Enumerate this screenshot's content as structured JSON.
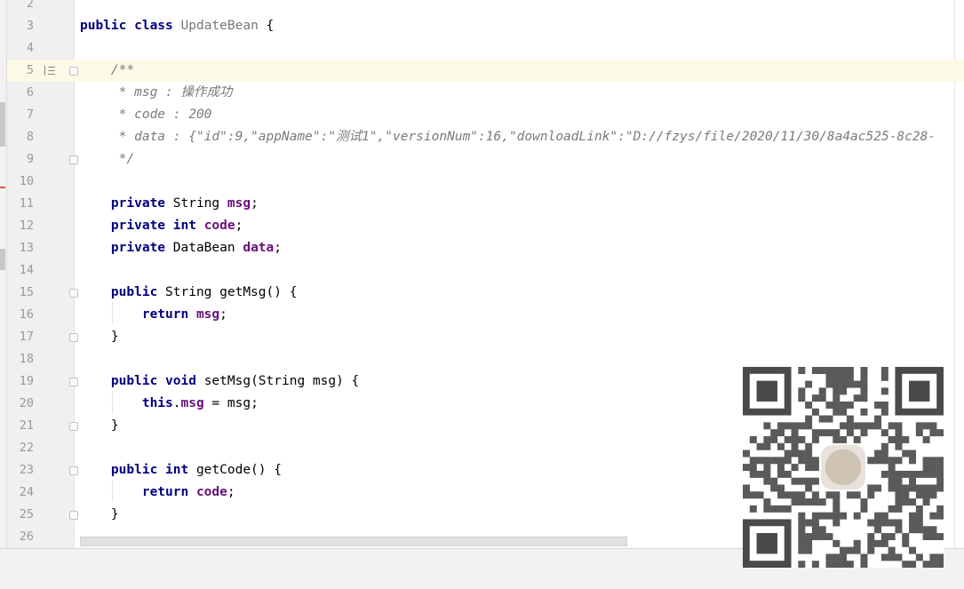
{
  "lines": [
    {
      "n": "2",
      "tokens": []
    },
    {
      "n": "3",
      "tokens": [
        {
          "t": "public class ",
          "c": "kw"
        },
        {
          "t": "UpdateBean",
          "c": "cls"
        },
        {
          "t": " {",
          "c": ""
        }
      ]
    },
    {
      "n": "4",
      "tokens": []
    },
    {
      "n": "5",
      "current": true,
      "tokens": [
        {
          "t": "    /**",
          "c": "cmt"
        }
      ]
    },
    {
      "n": "6",
      "tokens": [
        {
          "t": "     * msg : 操作成功",
          "c": "cmt"
        }
      ]
    },
    {
      "n": "7",
      "tokens": [
        {
          "t": "     * code : 200",
          "c": "cmt"
        }
      ]
    },
    {
      "n": "8",
      "tokens": [
        {
          "t": "     * data : {\"id\":9,\"appName\":\"测试1\",\"versionNum\":16,\"downloadLink\":\"D://fzys/file/2020/11/30/8a4ac525-8c28-",
          "c": "cmt"
        }
      ]
    },
    {
      "n": "9",
      "tokens": [
        {
          "t": "     */",
          "c": "cmt"
        }
      ]
    },
    {
      "n": "10",
      "tokens": []
    },
    {
      "n": "11",
      "tokens": [
        {
          "t": "    private ",
          "c": "kw"
        },
        {
          "t": "String ",
          "c": ""
        },
        {
          "t": "msg",
          "c": "fld"
        },
        {
          "t": ";",
          "c": ""
        }
      ]
    },
    {
      "n": "12",
      "tokens": [
        {
          "t": "    private int ",
          "c": "kw"
        },
        {
          "t": "code",
          "c": "fld"
        },
        {
          "t": ";",
          "c": ""
        }
      ]
    },
    {
      "n": "13",
      "tokens": [
        {
          "t": "    private ",
          "c": "kw"
        },
        {
          "t": "DataBean ",
          "c": ""
        },
        {
          "t": "data",
          "c": "fld"
        },
        {
          "t": ";",
          "c": ""
        }
      ]
    },
    {
      "n": "14",
      "tokens": []
    },
    {
      "n": "15",
      "tokens": [
        {
          "t": "    public ",
          "c": "kw"
        },
        {
          "t": "String getMsg() {",
          "c": ""
        }
      ]
    },
    {
      "n": "16",
      "tokens": [
        {
          "t": "        return ",
          "c": "kw"
        },
        {
          "t": "msg",
          "c": "fld"
        },
        {
          "t": ";",
          "c": ""
        }
      ]
    },
    {
      "n": "17",
      "tokens": [
        {
          "t": "    }",
          "c": ""
        }
      ]
    },
    {
      "n": "18",
      "tokens": []
    },
    {
      "n": "19",
      "tokens": [
        {
          "t": "    public void ",
          "c": "kw"
        },
        {
          "t": "setMsg(String msg) {",
          "c": ""
        }
      ]
    },
    {
      "n": "20",
      "tokens": [
        {
          "t": "        this",
          "c": "kw"
        },
        {
          "t": ".",
          "c": ""
        },
        {
          "t": "msg",
          "c": "fld"
        },
        {
          "t": " = msg;",
          "c": ""
        }
      ]
    },
    {
      "n": "21",
      "tokens": [
        {
          "t": "    }",
          "c": ""
        }
      ]
    },
    {
      "n": "22",
      "tokens": []
    },
    {
      "n": "23",
      "tokens": [
        {
          "t": "    public int ",
          "c": "kw"
        },
        {
          "t": "getCode() {",
          "c": ""
        }
      ]
    },
    {
      "n": "24",
      "tokens": [
        {
          "t": "        return ",
          "c": "kw"
        },
        {
          "t": "code",
          "c": "fld"
        },
        {
          "t": ";",
          "c": ""
        }
      ]
    },
    {
      "n": "25",
      "tokens": [
        {
          "t": "    }",
          "c": ""
        }
      ]
    },
    {
      "n": "26",
      "tokens": []
    }
  ],
  "folds": [
    "5",
    "9",
    "15",
    "17",
    "19",
    "21",
    "23",
    "25"
  ],
  "gutter_icons": [
    {
      "line": "5",
      "icon": "render-doc-icon"
    }
  ],
  "colors": {
    "keyword": "#000080",
    "field": "#660e7a",
    "comment": "#7a7a7a",
    "current_line": "#fcfae7"
  },
  "overlay": {
    "icon": "qr-code-icon"
  }
}
